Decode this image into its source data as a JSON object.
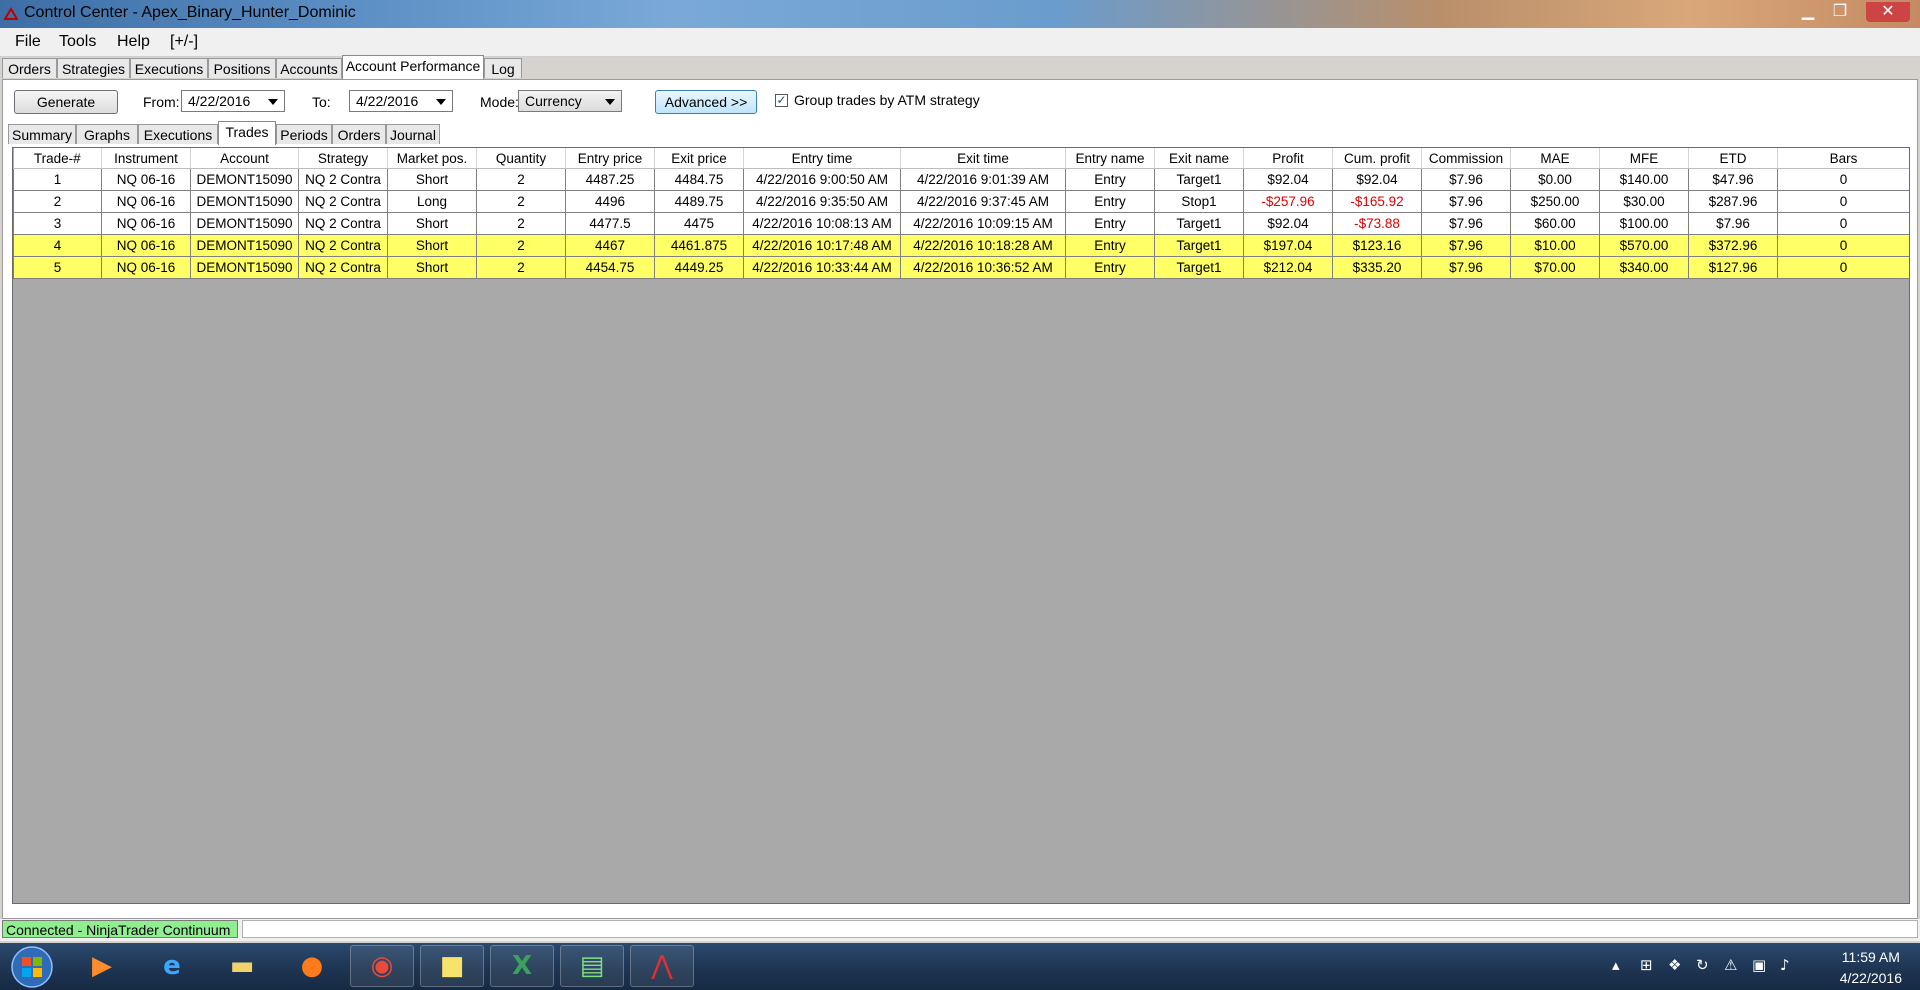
{
  "window": {
    "title": "Control Center - Apex_Binary_Hunter_Dominic",
    "minimize": "▁",
    "maximize": "❐",
    "close": "✕"
  },
  "menu": [
    "File",
    "Tools",
    "Help",
    "[+/-]"
  ],
  "main_tabs": [
    "Orders",
    "Strategies",
    "Executions",
    "Positions",
    "Accounts",
    "Account Performance",
    "Log"
  ],
  "main_tabs_active": "Account Performance",
  "toolbar": {
    "generate": "Generate",
    "from_label": "From:",
    "from_value": "4/22/2016",
    "to_label": "To:",
    "to_value": "4/22/2016",
    "mode_label": "Mode:",
    "mode_value": "Currency",
    "advanced": "Advanced >>",
    "group_checked": true,
    "group_label": "Group trades by ATM strategy"
  },
  "sub_tabs": [
    "Summary",
    "Graphs",
    "Executions",
    "Trades",
    "Periods",
    "Orders",
    "Journal"
  ],
  "sub_tabs_active": "Trades",
  "table": {
    "columns": [
      "Trade-#",
      "Instrument",
      "Account",
      "Strategy",
      "Market pos.",
      "Quantity",
      "Entry price",
      "Exit price",
      "Entry time",
      "Exit time",
      "Entry name",
      "Exit name",
      "Profit",
      "Cum. profit",
      "Commission",
      "MAE",
      "MFE",
      "ETD",
      "Bars"
    ],
    "rows": [
      [
        "1",
        "NQ 06-16",
        "DEMONT15090",
        "NQ 2 Contra",
        "Short",
        "2",
        "4487.25",
        "4484.75",
        "4/22/2016 9:00:50 AM",
        "4/22/2016 9:01:39 AM",
        "Entry",
        "Target1",
        "$92.04",
        "$92.04",
        "$7.96",
        "$0.00",
        "$140.00",
        "$47.96",
        "0"
      ],
      [
        "2",
        "NQ 06-16",
        "DEMONT15090",
        "NQ 2 Contra",
        "Long",
        "2",
        "4496",
        "4489.75",
        "4/22/2016 9:35:50 AM",
        "4/22/2016 9:37:45 AM",
        "Entry",
        "Stop1",
        "-$257.96",
        "-$165.92",
        "$7.96",
        "$250.00",
        "$30.00",
        "$287.96",
        "0"
      ],
      [
        "3",
        "NQ 06-16",
        "DEMONT15090",
        "NQ 2 Contra",
        "Short",
        "2",
        "4477.5",
        "4475",
        "4/22/2016 10:08:13 AM",
        "4/22/2016 10:09:15 AM",
        "Entry",
        "Target1",
        "$92.04",
        "-$73.88",
        "$7.96",
        "$60.00",
        "$100.00",
        "$7.96",
        "0"
      ],
      [
        "4",
        "NQ 06-16",
        "DEMONT15090",
        "NQ 2 Contra",
        "Short",
        "2",
        "4467",
        "4461.875",
        "4/22/2016 10:17:48 AM",
        "4/22/2016 10:18:28 AM",
        "Entry",
        "Target1",
        "$197.04",
        "$123.16",
        "$7.96",
        "$10.00",
        "$570.00",
        "$372.96",
        "0"
      ],
      [
        "5",
        "NQ 06-16",
        "DEMONT15090",
        "NQ 2 Contra",
        "Short",
        "2",
        "4454.75",
        "4449.25",
        "4/22/2016 10:33:44 AM",
        "4/22/2016 10:36:52 AM",
        "Entry",
        "Target1",
        "$212.04",
        "$335.20",
        "$7.96",
        "$70.00",
        "$340.00",
        "$127.96",
        "0"
      ]
    ],
    "highlighted_rows": [
      3,
      4
    ],
    "negative_color": "#e00000",
    "highlight_color": "#ffff66"
  },
  "status": {
    "connection": "Connected - NinjaTrader Continuum",
    "connection_color": "#90ee90"
  },
  "taskbar": {
    "items": [
      "start-orb-icon",
      "media-player-icon",
      "internet-explorer-icon",
      "file-explorer-icon",
      "firefox-icon",
      "chrome-icon",
      "sticky-notes-icon",
      "excel-icon",
      "network-monitor-icon",
      "ninjatrader-icon"
    ],
    "time": "11:59 AM",
    "date": "4/22/2016"
  }
}
